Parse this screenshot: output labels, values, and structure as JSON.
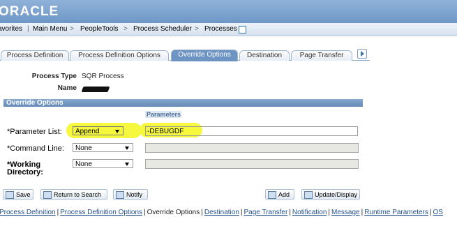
{
  "app": {
    "logo": "ORACLE"
  },
  "nav": {
    "items": [
      "avorites",
      "Main Menu",
      "PeopleTools",
      "Process Scheduler",
      "Processes"
    ],
    "separators": [
      "|",
      ">",
      ">",
      ">"
    ]
  },
  "tabs": [
    {
      "label": "Process Definition",
      "active": false
    },
    {
      "label": "Process Definition Options",
      "active": false
    },
    {
      "label": "Override Options",
      "active": true
    },
    {
      "label": "Destination",
      "active": false
    },
    {
      "label": "Page Transfer",
      "active": false
    }
  ],
  "process": {
    "type_label": "Process Type",
    "type_value": "SQR Process",
    "name_label": "Name"
  },
  "section": {
    "title": "Override Options",
    "params_header": "Parameters"
  },
  "fields": [
    {
      "label": "*Parameter List:",
      "select": "Append",
      "value": "-DEBUGDF"
    },
    {
      "label": "*Command Line:",
      "select": "None",
      "value": ""
    },
    {
      "label_line1": "*Working",
      "label_line2": "Directory:",
      "select": "None",
      "value": ""
    }
  ],
  "buttons": {
    "save": "Save",
    "return": "Return to Search",
    "notify": "Notify",
    "add": "Add",
    "update": "Update/Display"
  },
  "bottom_links": [
    "Process Definition",
    "Process Definition Options",
    "Override Options",
    "Destination",
    "Page Transfer",
    "Notification",
    "Message",
    "Runtime Parameters",
    "OS"
  ],
  "colors": {
    "header": "#7fa4d0",
    "highlight": "#f5f83d",
    "section_bar": "#6f93bf"
  }
}
